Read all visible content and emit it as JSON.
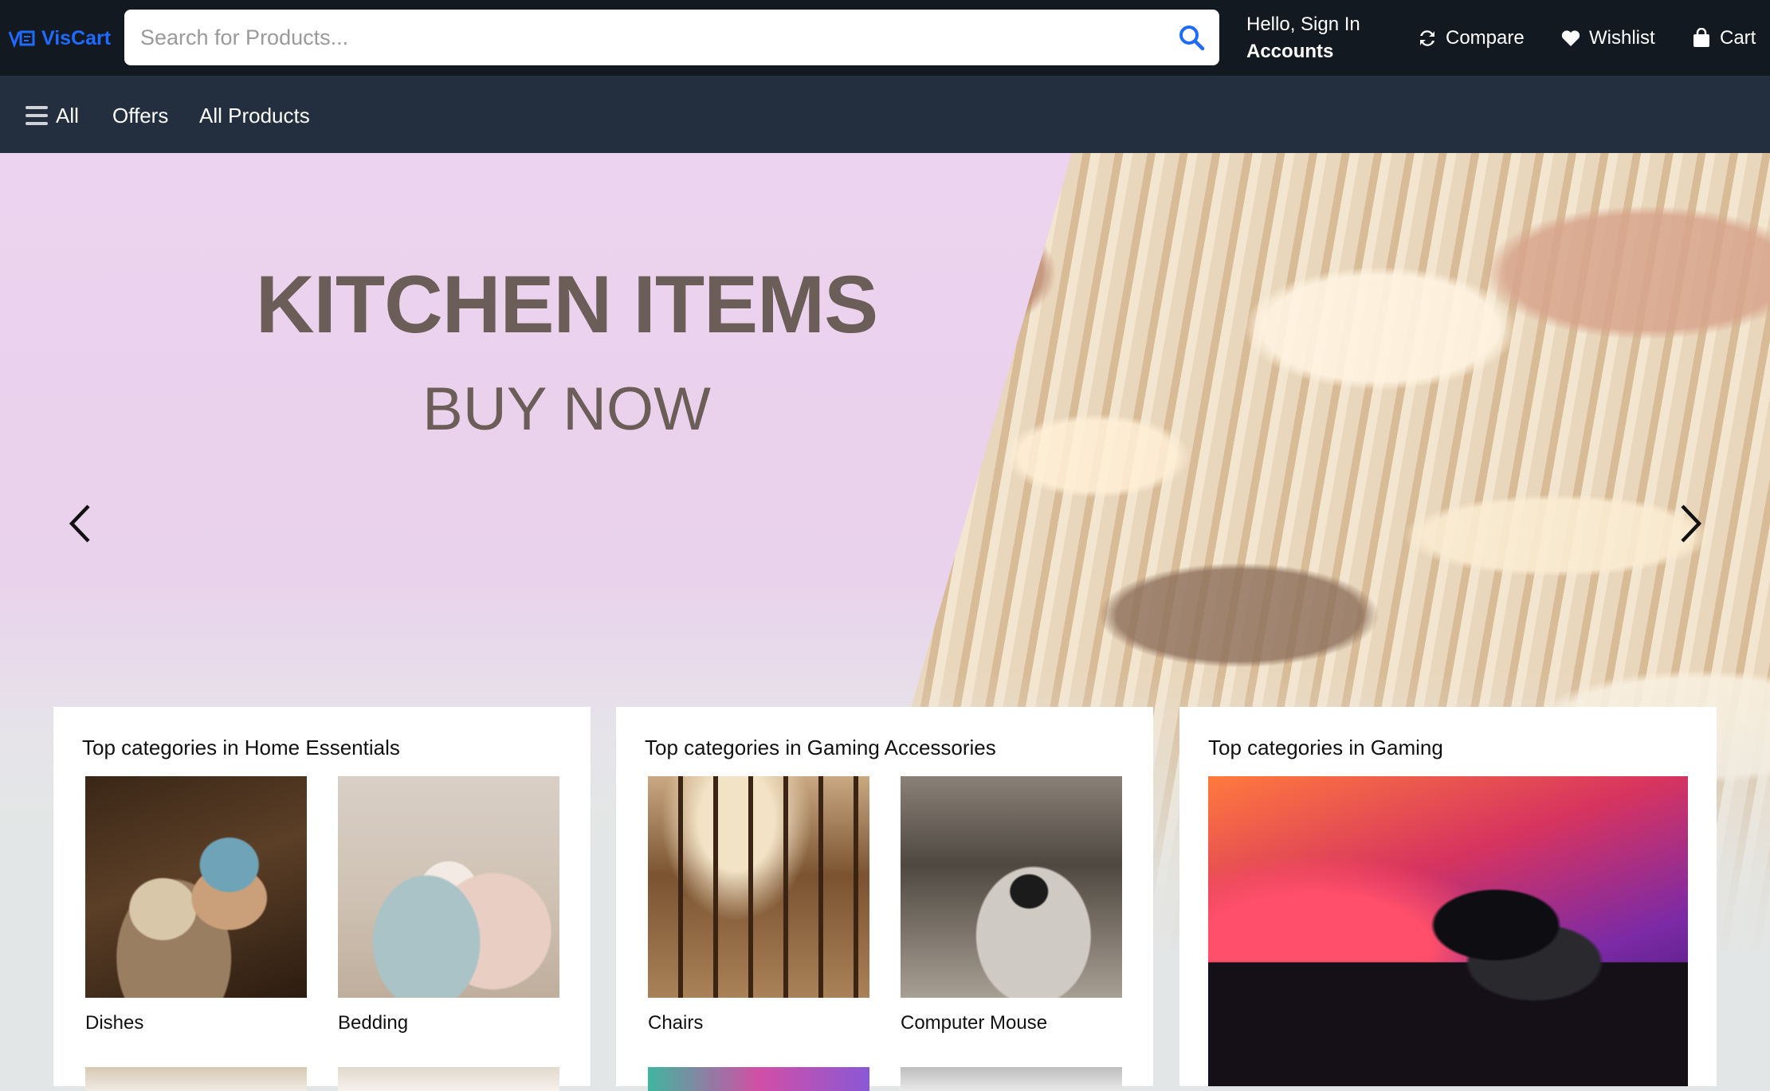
{
  "header": {
    "logo_text": "VisCart",
    "search_placeholder": "Search for Products...",
    "account_greeting": "Hello, Sign In",
    "account_label": "Accounts",
    "compare_label": "Compare",
    "wishlist_label": "Wishlist",
    "cart_label": "Cart"
  },
  "subnav": {
    "all_label": "All",
    "offers_label": "Offers",
    "products_label": "All Products"
  },
  "hero": {
    "title": "KITCHEN ITEMS",
    "subtitle": "BUY NOW",
    "bg_color": "#ecd3ef",
    "text_color": "#6b5d57"
  },
  "cards": [
    {
      "title": "Top categories in Home Essentials",
      "items": [
        {
          "label": "Dishes"
        },
        {
          "label": "Bedding"
        }
      ]
    },
    {
      "title": "Top categories in Gaming Accessories",
      "items": [
        {
          "label": "Chairs"
        },
        {
          "label": "Computer Mouse"
        }
      ]
    },
    {
      "title": "Top categories in Gaming"
    }
  ],
  "colors": {
    "topbar": "#131921",
    "subnav": "#232f3e",
    "accent": "#1f6bff"
  }
}
